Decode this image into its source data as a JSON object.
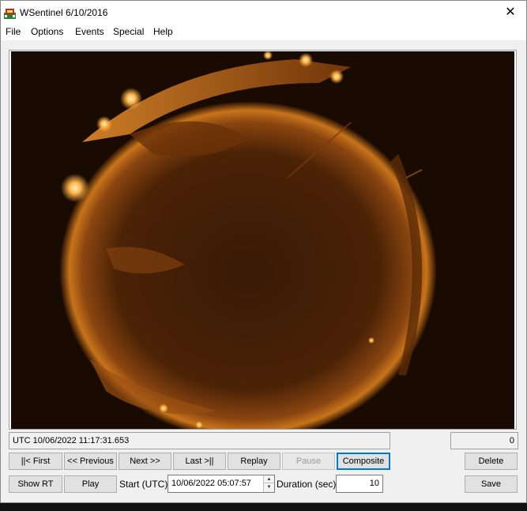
{
  "window": {
    "title": "WSentinel 6/10/2016",
    "close_glyph": "✕",
    "app_icon": "wsentinel-app-icon"
  },
  "menu": {
    "items": [
      "File",
      "Options",
      "Events",
      "Special",
      "Help"
    ]
  },
  "image": {
    "description_icon": "all-sky-camera-frame"
  },
  "status": {
    "timestamp": "UTC 10/06/2022 11:17:31.653",
    "counter": "0"
  },
  "controls": {
    "first": "||< First",
    "previous": "<< Previous",
    "next": "Next >>",
    "last": "Last >||",
    "replay": "Replay",
    "pause": "Pause",
    "composite": "Composite",
    "delete": "Delete",
    "show_rt": "Show RT",
    "play": "Play",
    "start_label": "Start (UTC):",
    "start_value": "10/06/2022 05:07:57",
    "duration_label": "Duration (sec):",
    "duration_value": "10",
    "save": "Save"
  },
  "colors": {
    "image_glow": "#c8741a",
    "image_dark": "#1a0b02",
    "accent_focus": "#0078d7"
  }
}
